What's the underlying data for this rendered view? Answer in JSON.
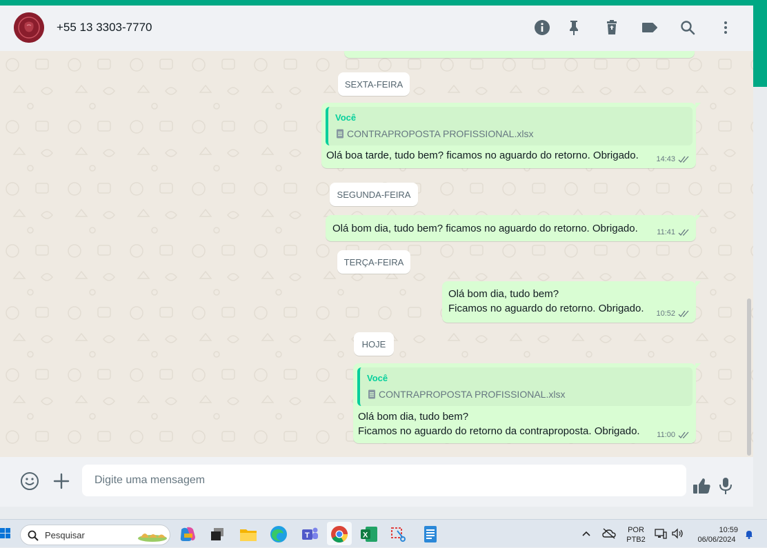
{
  "header": {
    "contact_name": "+55 13 3303-7770",
    "icons": [
      "info-icon",
      "pin-icon",
      "delete-icon",
      "label-icon",
      "search-icon",
      "more-icon"
    ]
  },
  "conversation": {
    "day_chips": {
      "friday": "SEXTA-FEIRA",
      "monday": "SEGUNDA-FEIRA",
      "tuesday": "TERÇA-FEIRA",
      "today": "HOJE"
    },
    "messages": [
      {
        "reply_author": "Você",
        "reply_file": "CONTRAPROPOSTA PROFISSIONAL.xlsx",
        "text": "Olá boa tarde, tudo bem? ficamos no aguardo do retorno. Obrigado.",
        "time": "14:43",
        "status": "read"
      },
      {
        "text": "Olá bom dia, tudo bem? ficamos no aguardo do retorno. Obrigado.",
        "time": "11:41",
        "status": "read"
      },
      {
        "text": "Olá bom dia, tudo bem?\nFicamos no aguardo do retorno. Obrigado.",
        "time": "10:52",
        "status": "read"
      },
      {
        "reply_author": "Você",
        "reply_file": "CONTRAPROPOSTA PROFISSIONAL.xlsx",
        "text": "Olá bom dia, tudo bem?\nFicamos no aguardo do retorno da contraproposta. Obrigado.",
        "time": "11:00",
        "status": "read"
      }
    ]
  },
  "composer": {
    "placeholder": "Digite uma mensagem",
    "icons": [
      "emoji-icon",
      "plus-icon",
      "thumbs-up-icon",
      "microphone-icon"
    ]
  },
  "taskbar": {
    "search_placeholder": "Pesquisar",
    "apps": [
      "widgets-icon",
      "copilot-icon",
      "task-view-icon",
      "file-explorer-icon",
      "edge-icon",
      "teams-icon",
      "chrome-icon",
      "excel-icon",
      "snipping-tool-icon",
      "notepad-icon"
    ],
    "language": "POR",
    "keyboard": "PTB2",
    "time": "10:59",
    "date": "06/06/2024"
  },
  "colors": {
    "accent": "#00a884",
    "bubble_outgoing": "#d9fdd3",
    "quote_bar": "#06cf9c",
    "read_ticks": "#667781"
  }
}
